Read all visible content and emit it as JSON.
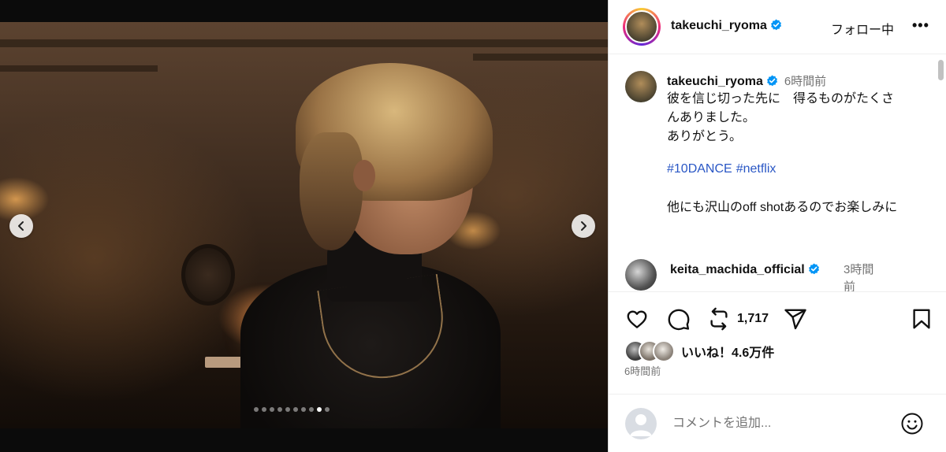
{
  "post": {
    "username": "takeuchi_ryoma",
    "follow_label": "フォロー中",
    "more_label": "•••",
    "carousel": {
      "slide_count": 10,
      "active_index": 8
    }
  },
  "caption": {
    "username": "takeuchi_ryoma",
    "time": "6時間前",
    "text": "彼を信じ切った先に　得るものがたくさんありました。\nありがとう。",
    "hashtags": [
      "#10DANCE",
      "#netflix"
    ],
    "text2": "他にも沢山のoff shotあるのでお楽しみに"
  },
  "comment": {
    "username": "keita_machida_official",
    "time": "3時間前"
  },
  "actions": {
    "repost_count": "1,717",
    "likes_label": "いいね！4.6万件",
    "time": "6時間前"
  },
  "composer": {
    "placeholder": "コメントを追加..."
  },
  "colors": {
    "accent": "#0095f6",
    "hashtag": "#2a57c5",
    "muted": "#737373",
    "verified": "#0095f6"
  },
  "icons": [
    "chevron-left-icon",
    "chevron-right-icon",
    "heart-icon",
    "comment-icon",
    "repost-icon",
    "share-icon",
    "bookmark-icon",
    "emoji-icon",
    "verified-icon"
  ]
}
